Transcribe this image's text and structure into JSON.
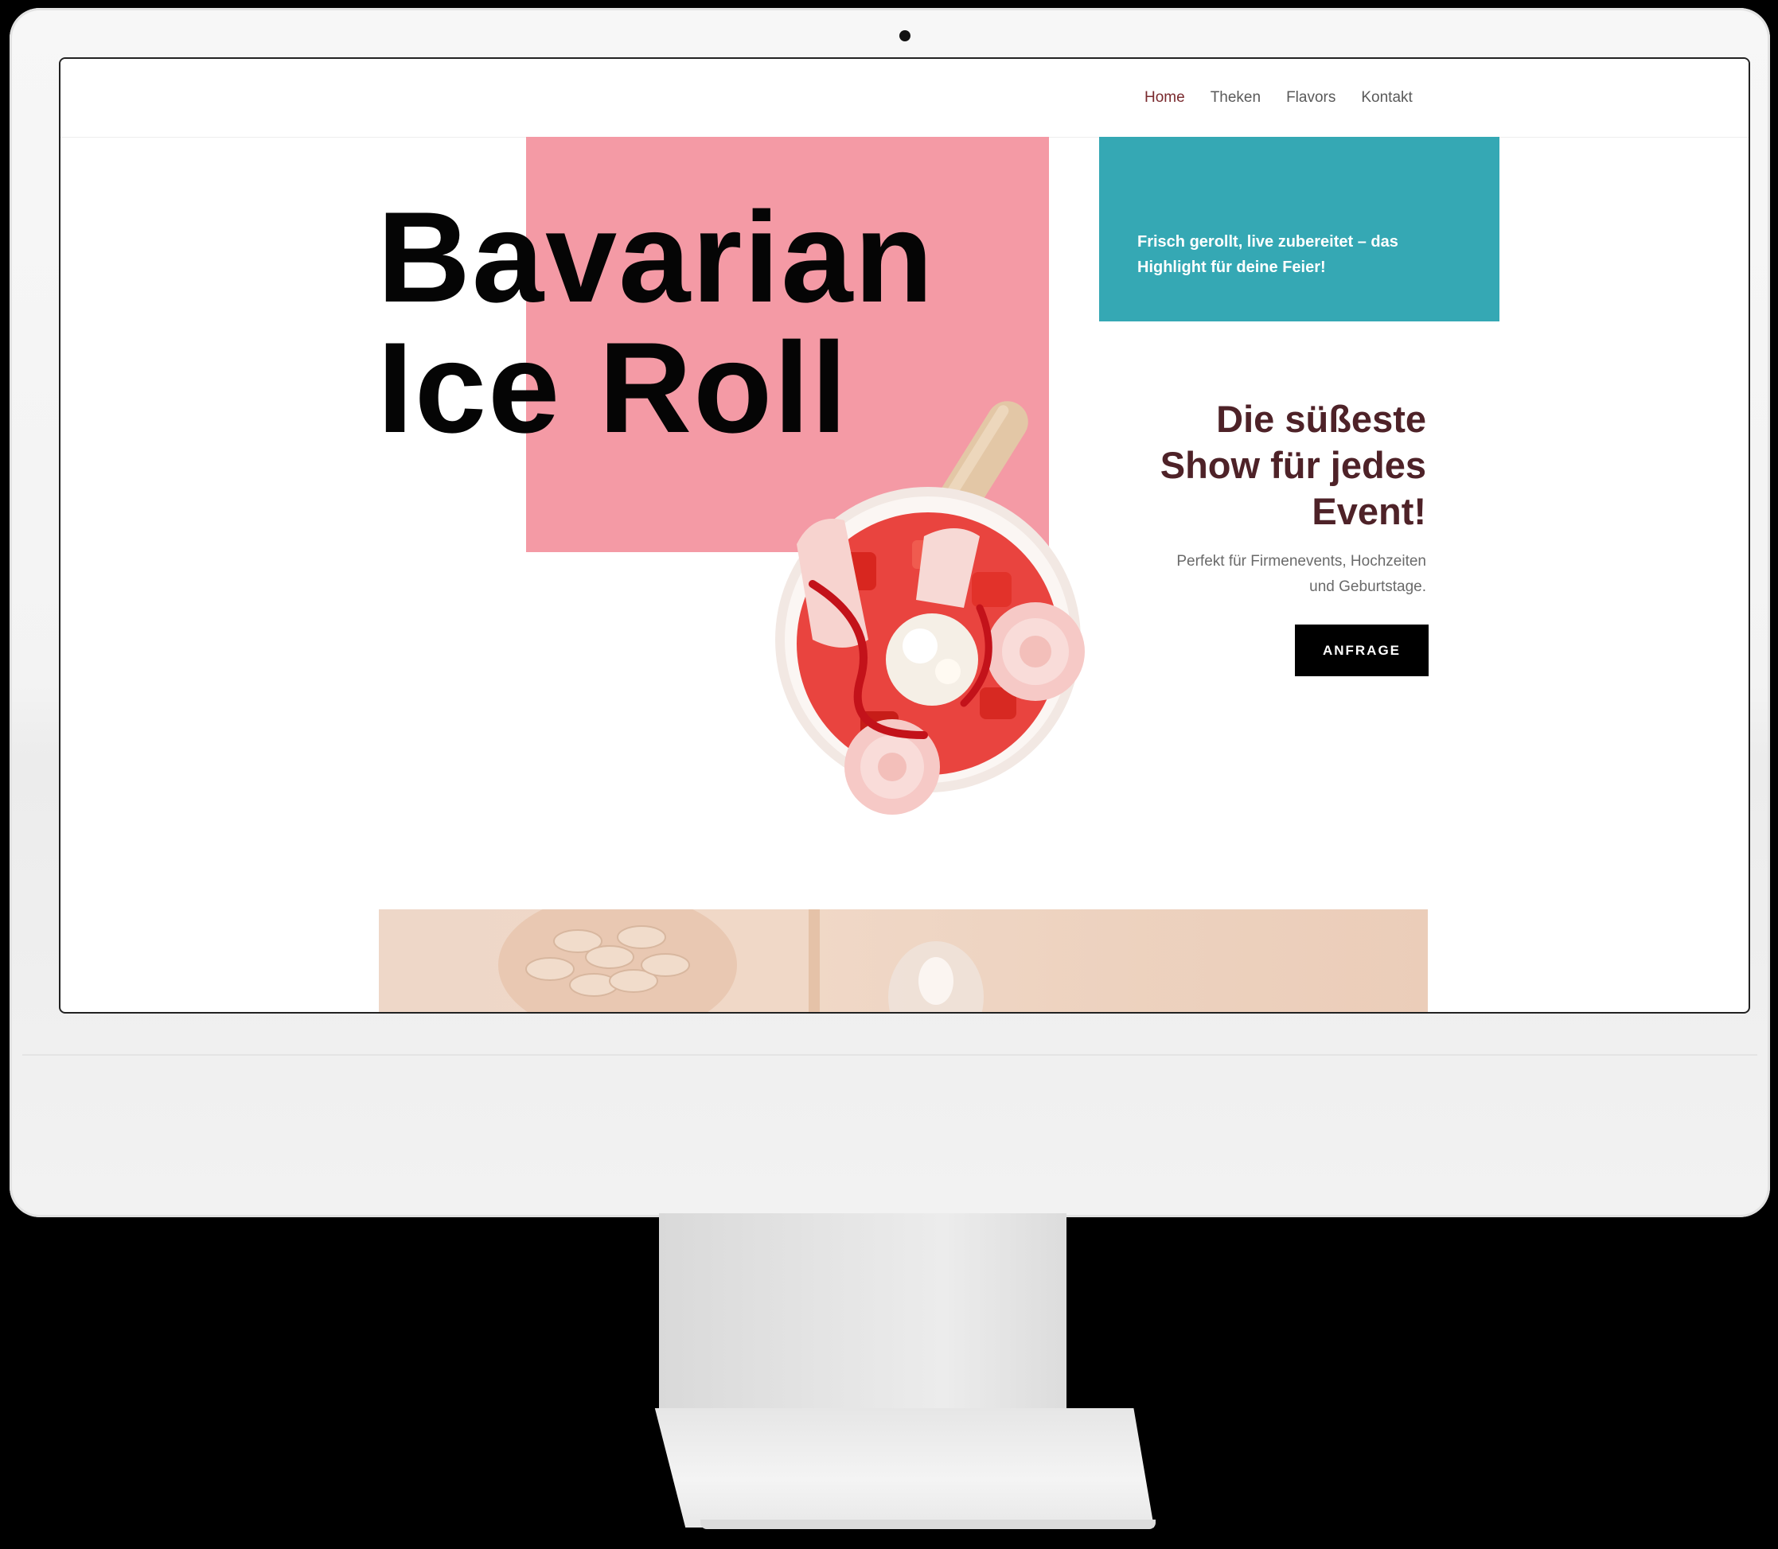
{
  "nav": {
    "items": [
      {
        "label": "Home",
        "active": true
      },
      {
        "label": "Theken",
        "active": false
      },
      {
        "label": "Flavors",
        "active": false
      },
      {
        "label": "Kontakt",
        "active": false
      }
    ]
  },
  "hero": {
    "title_line1": "Bavarian",
    "title_line2": "Ice Roll",
    "teal_text": "Frisch gerollt, live zubereitet – das Highlight für deine Feier!",
    "subtitle_line1": "Die süßeste",
    "subtitle_line2": "Show für jedes",
    "subtitle_line3": "Event!",
    "description_line1": "Perfekt für Firmenevents, Hochzeiten",
    "description_line2": "und Geburtstage.",
    "cta_label": "ANFRAGE"
  },
  "colors": {
    "pink": "#f49aa5",
    "teal": "#35a8b4",
    "heading": "#4e2228",
    "nav_active": "#7a2a2e",
    "button": "#000000"
  }
}
